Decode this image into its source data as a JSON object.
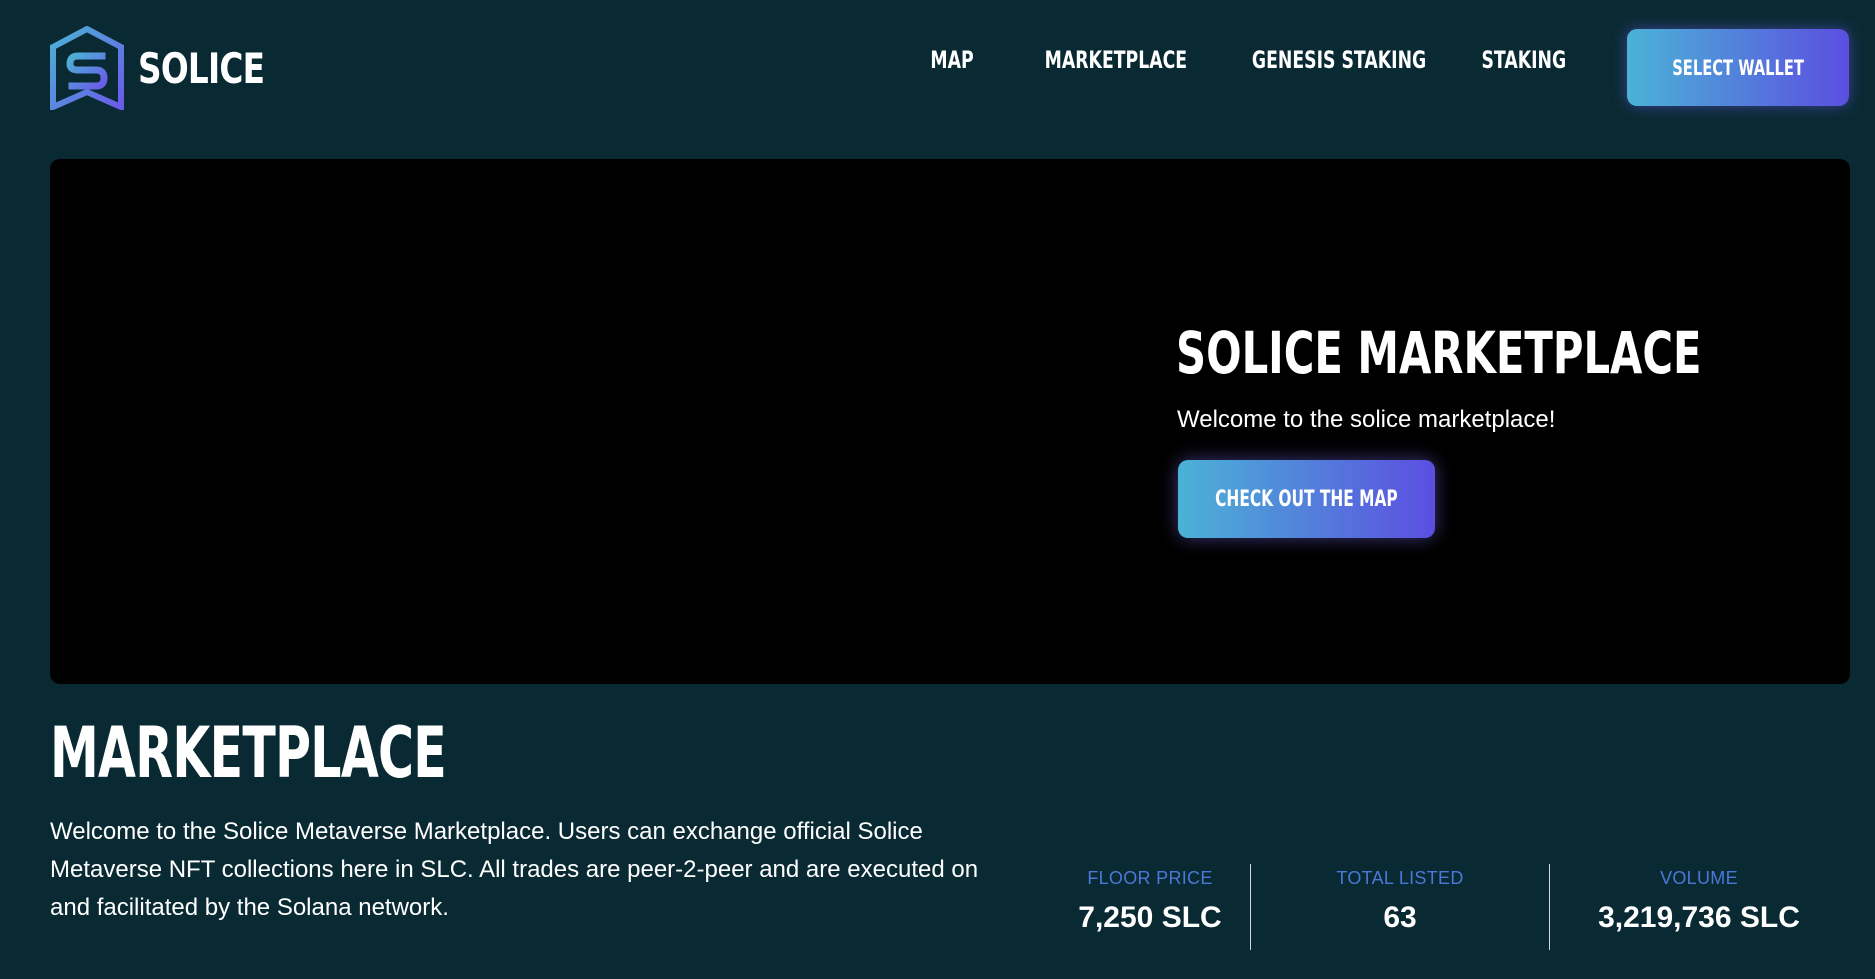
{
  "header": {
    "brand_name": "SOLICE",
    "logo_icon": "solice-logo-icon",
    "nav": [
      {
        "label": "MAP"
      },
      {
        "label": "MARKETPLACE"
      },
      {
        "label": "GENESIS STAKING"
      },
      {
        "label": "STAKING"
      }
    ],
    "wallet_button_label": "SELECT WALLET"
  },
  "hero": {
    "title": "SOLICE MARKETPLACE",
    "subtitle": "Welcome to the solice marketplace!",
    "cta_label": "CHECK OUT THE MAP"
  },
  "marketplace": {
    "title": "MARKETPLACE",
    "description": "Welcome to the Solice Metaverse Marketplace. Users can exchange official Solice Metaverse NFT collections here in SLC. All trades are peer-2-peer and are executed on and facilitated by the Solana network.",
    "stats": [
      {
        "label": "FLOOR PRICE",
        "value": "7,250 SLC"
      },
      {
        "label": "TOTAL LISTED",
        "value": "63"
      },
      {
        "label": "VOLUME",
        "value": "3,219,736 SLC"
      }
    ]
  },
  "colors": {
    "background": "#0a2a33",
    "hero_background": "#000000",
    "gradient_start": "#4bb3d6",
    "gradient_end": "#5b4ee0",
    "stat_label": "#4a78d8"
  }
}
